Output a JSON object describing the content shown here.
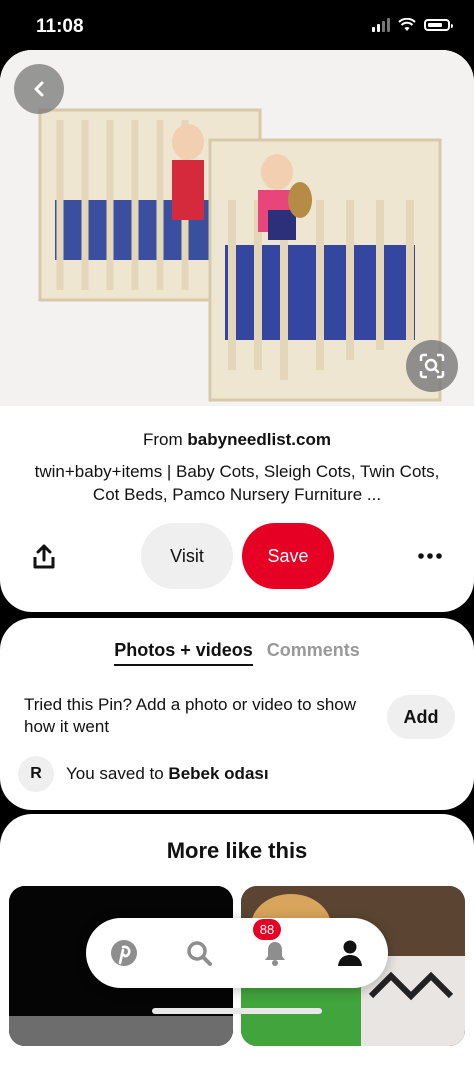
{
  "status_bar": {
    "time": "11:08"
  },
  "pin": {
    "source_prefix": "From",
    "source_domain": "babyneedlist.com",
    "title": "twin+baby+items | Baby Cots, Sleigh Cots, Twin Cots, Cot Beds, Pamco Nursery Furniture ...",
    "visit_label": "Visit",
    "save_label": "Save"
  },
  "tried": {
    "tabs": [
      {
        "label": "Photos + videos",
        "active": true
      },
      {
        "label": "Comments",
        "active": false
      }
    ],
    "prompt": "Tried this Pin? Add a photo or video to show how it went",
    "add_label": "Add",
    "avatar_initial": "R",
    "saved_prefix": "You saved to",
    "board_name": "Bebek odası"
  },
  "more": {
    "title": "More like this"
  },
  "nav": {
    "items": [
      {
        "icon": "pinterest-logo-icon"
      },
      {
        "icon": "search-icon"
      },
      {
        "icon": "bell-icon"
      },
      {
        "icon": "profile-icon"
      }
    ],
    "notification_count": "88"
  },
  "colors": {
    "brand_red": "#e60023",
    "button_gray": "#efefef"
  }
}
